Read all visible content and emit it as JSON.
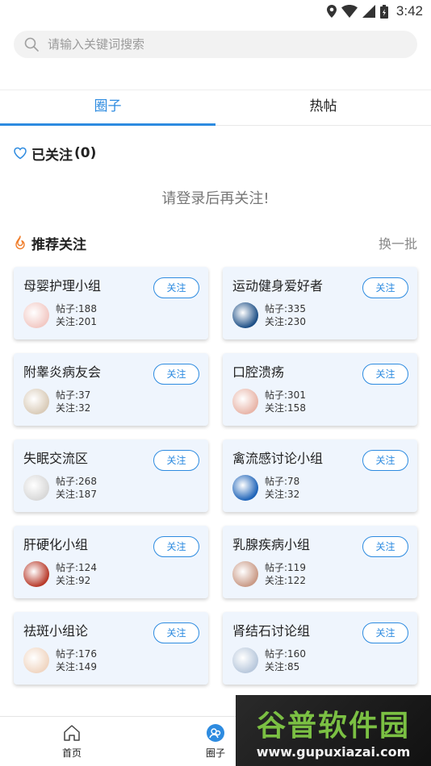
{
  "status_bar": {
    "time": "3:42"
  },
  "search": {
    "placeholder": "请输入关键词搜索"
  },
  "tabs": [
    {
      "label": "圈子",
      "active": true
    },
    {
      "label": "热帖",
      "active": false
    }
  ],
  "followed": {
    "title": "已关注",
    "count": "(0)",
    "empty_hint": "请登录后再关注!"
  },
  "recommended": {
    "title": "推荐关注",
    "refresh_label": "换一批",
    "follow_label": "关注",
    "groups": [
      {
        "name": "母婴护理小组",
        "posts": "帖子:188",
        "followers": "关注:201",
        "avatar_color": "#f2c9c4"
      },
      {
        "name": "运动健身爱好者",
        "posts": "帖子:335",
        "followers": "关注:230",
        "avatar_color": "#1d4f86"
      },
      {
        "name": "附睾炎病友会",
        "posts": "帖子:37",
        "followers": "关注:32",
        "avatar_color": "#d9cbb8"
      },
      {
        "name": "口腔溃疡",
        "posts": "帖子:301",
        "followers": "关注:158",
        "avatar_color": "#e8b5a8"
      },
      {
        "name": "失眠交流区",
        "posts": "帖子:268",
        "followers": "关注:187",
        "avatar_color": "#d8d8d8"
      },
      {
        "name": "禽流感讨论小组",
        "posts": "帖子:78",
        "followers": "关注:32",
        "avatar_color": "#1e63b8"
      },
      {
        "name": "肝硬化小组",
        "posts": "帖子:124",
        "followers": "关注:92",
        "avatar_color": "#b83a2a"
      },
      {
        "name": "乳腺疾病小组",
        "posts": "帖子:119",
        "followers": "关注:122",
        "avatar_color": "#c99a86"
      },
      {
        "name": "祛斑小组论",
        "posts": "帖子:176",
        "followers": "关注:149",
        "avatar_color": "#f0d6c2"
      },
      {
        "name": "肾结石讨论组",
        "posts": "帖子:160",
        "followers": "关注:85",
        "avatar_color": "#b8c8dc"
      }
    ]
  },
  "bottom_nav": [
    {
      "label": "首页",
      "icon": "home-icon"
    },
    {
      "label": "圈子",
      "icon": "circle-group-icon"
    },
    {
      "label": "",
      "icon": "profile-icon"
    }
  ],
  "watermark": {
    "text": "谷普软件园",
    "url": "www.gupuxiazai.com"
  },
  "colors": {
    "accent": "#2d8be0",
    "card_bg": "#eff5fd",
    "fire": "#f07d2a"
  }
}
